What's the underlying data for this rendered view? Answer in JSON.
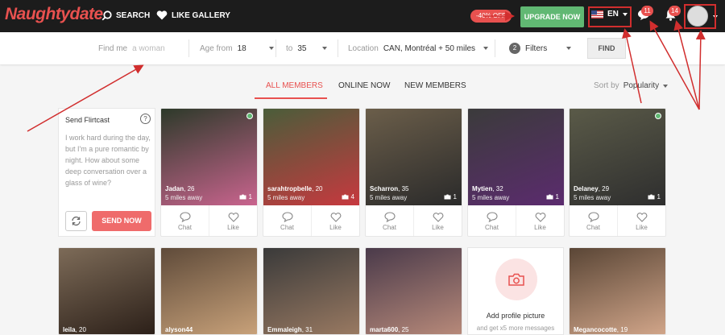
{
  "topbar": {
    "logo": "Naughtydate",
    "nav": [
      {
        "label": "SEARCH"
      },
      {
        "label": "LIKE GALLERY"
      }
    ],
    "discount": "-40% OFF",
    "upgrade": "UPGRADE NOW",
    "language": "EN",
    "messages_count": "11",
    "notifications_count": "14"
  },
  "search": {
    "find_me_label": "Find me",
    "find_me_value": "a woman",
    "age_from_label": "Age from",
    "age_from_value": "18",
    "age_to_label": "to",
    "age_to_value": "35",
    "location_label": "Location",
    "location_value": "CAN, Montréal + 50 miles",
    "filters_count": "2",
    "filters_label": "Filters",
    "find_button": "FIND"
  },
  "tabs": [
    {
      "label": "ALL MEMBERS"
    },
    {
      "label": "ONLINE NOW"
    },
    {
      "label": "NEW MEMBERS"
    }
  ],
  "sort": {
    "label": "Sort by",
    "value": "Popularity"
  },
  "flirtcast": {
    "title": "Send Flirtcast",
    "help": "?",
    "message": "I work hard during the day, but I'm a pure romantic by night. How about some deep conversation over a glass of wine?",
    "send": "SEND NOW"
  },
  "members_row1": [
    {
      "name": "Jadan",
      "age": ", 26",
      "distance": "5 miles away",
      "photos": "1",
      "online": true,
      "colors": [
        "#2d3a2a",
        "#c9648e"
      ]
    },
    {
      "name": "sarahtropbelle",
      "age": ", 20",
      "distance": "5 miles away",
      "photos": "4",
      "online": false,
      "colors": [
        "#4a5d3a",
        "#c7393f"
      ]
    },
    {
      "name": "Scharron",
      "age": ", 35",
      "distance": "5 miles away",
      "photos": "1",
      "online": false,
      "colors": [
        "#6b5e4a",
        "#2a2a2a"
      ]
    },
    {
      "name": "Mytien",
      "age": ", 32",
      "distance": "5 miles away",
      "photos": "1",
      "online": false,
      "colors": [
        "#3b3b3b",
        "#5b2b6e"
      ]
    },
    {
      "name": "Delaney",
      "age": ", 29",
      "distance": "5 miles away",
      "photos": "1",
      "online": true,
      "colors": [
        "#5a5a48",
        "#2e2e2e"
      ]
    }
  ],
  "members_row2": [
    {
      "name": "leila",
      "age": ", 20",
      "colors": [
        "#7d6b58",
        "#2b1f18"
      ]
    },
    {
      "name": "alyson44",
      "age": "",
      "colors": [
        "#5f4b3a",
        "#c9a27a"
      ]
    },
    {
      "name": "Emmaleigh",
      "age": ", 31",
      "colors": [
        "#3a3a3a",
        "#9a7a62"
      ]
    },
    {
      "name": "marta600",
      "age": ", 25",
      "colors": [
        "#4a3a4a",
        "#b88a7a"
      ]
    },
    {
      "name": "Megancocotte",
      "age": ", 19",
      "colors": [
        "#5a4636",
        "#d2a68a"
      ]
    }
  ],
  "action_labels": {
    "chat": "Chat",
    "like": "Like"
  },
  "add_picture": {
    "title": "Add profile picture",
    "subtitle": "and get x5 more messages"
  },
  "accent": "#e8514f"
}
